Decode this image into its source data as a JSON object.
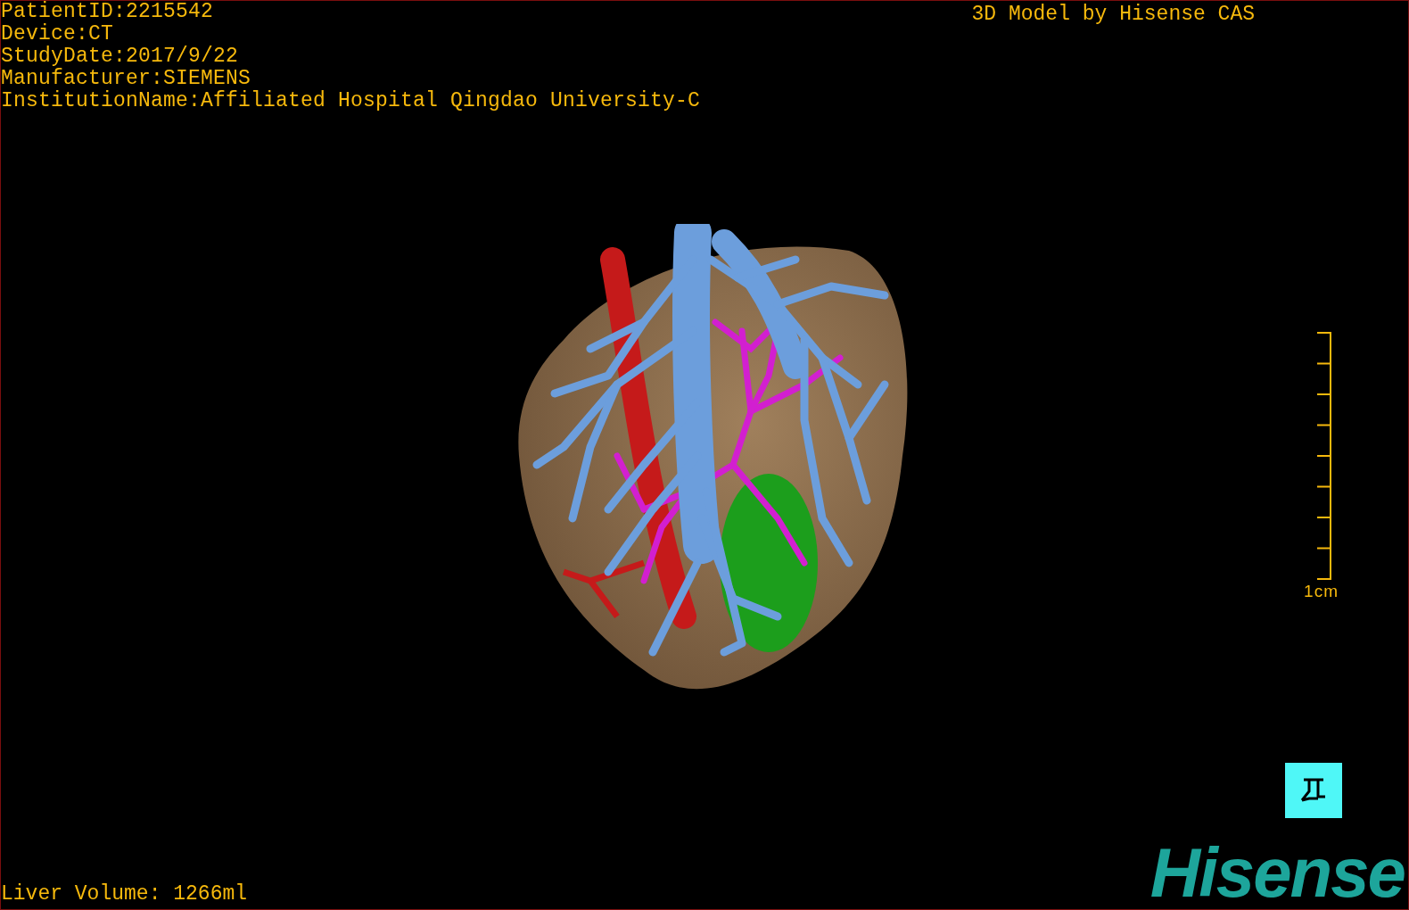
{
  "info_lines": [
    "PatientID:2215542",
    "Device:CT",
    "StudyDate:2017/9/22",
    "Manufacturer:SIEMENS",
    "InstitutionName:Affiliated Hospital Qingdao University-C"
  ],
  "model_credit": "3D Model by Hisense CAS",
  "scale": {
    "label": "1cm"
  },
  "liver_volume": "Liver Volume: 1266ml",
  "logo": "Hisense"
}
